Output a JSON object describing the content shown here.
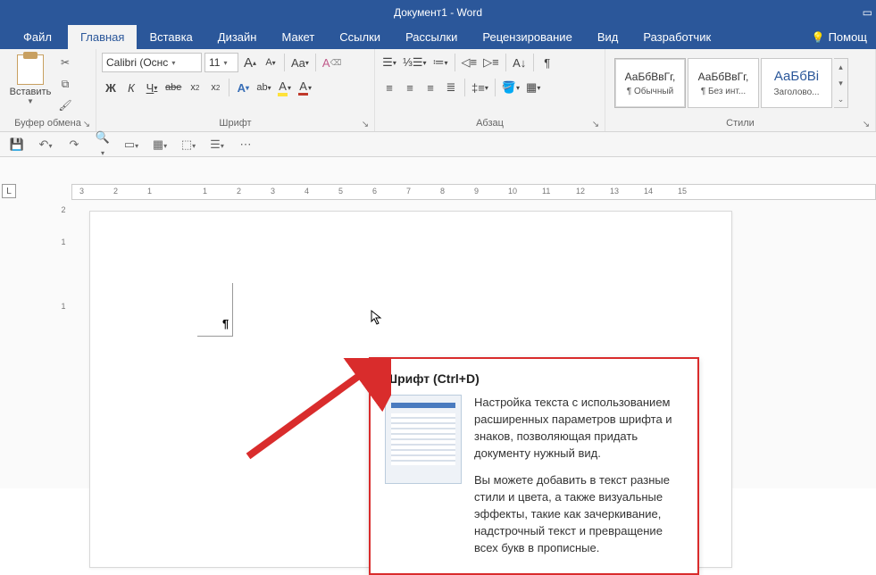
{
  "titlebar": {
    "title": "Документ1 - Word"
  },
  "tabs": {
    "file": "Файл",
    "home": "Главная",
    "insert": "Вставка",
    "design": "Дизайн",
    "layout": "Макет",
    "references": "Ссылки",
    "mailings": "Рассылки",
    "review": "Рецензирование",
    "view": "Вид",
    "developer": "Разработчик",
    "help": "Помощ"
  },
  "ribbon": {
    "clipboard": {
      "paste": "Вставить",
      "label": "Буфер обмена"
    },
    "font": {
      "name": "Calibri (Оснс",
      "size": "11",
      "label": "Шрифт",
      "bold": "Ж",
      "italic": "К",
      "underline": "Ч",
      "strike": "abe",
      "sub": "x",
      "sup": "x",
      "grow": "A",
      "shrink": "A",
      "case": "Aa",
      "clear": "A",
      "effects": "A",
      "charborder": "ab",
      "highlight": "A",
      "fontcolor": "A"
    },
    "paragraph": {
      "label": "Абзац"
    },
    "styles": {
      "label": "Стили",
      "preview": "АаБбВвГг,",
      "heading_preview": "АаБбВі",
      "normal": "¶ Обычный",
      "no_spacing": "¶ Без инт...",
      "heading1": "Заголово..."
    }
  },
  "tooltip": {
    "title": "Шрифт (Ctrl+D)",
    "p1": "Настройка текста с использованием расширенных параметров шрифта и знаков, позволяющая придать документу нужный вид.",
    "p2": "Вы можете добавить в текст разные стили и цвета, а также визуальные эффекты, такие как зачеркивание, надстрочный текст и превращение всех букв в прописные."
  },
  "ruler": {
    "left": [
      "3",
      "2",
      "1"
    ],
    "right": [
      "1",
      "2",
      "3",
      "4",
      "5",
      "6",
      "7",
      "8",
      "9",
      "10",
      "11",
      "12",
      "13",
      "14",
      "15"
    ]
  },
  "vruler": [
    "2",
    "1",
    "",
    "1"
  ]
}
